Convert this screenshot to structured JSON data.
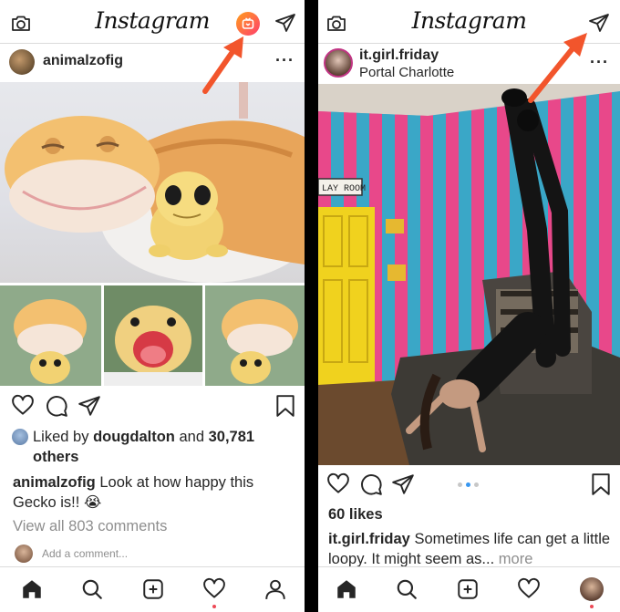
{
  "left": {
    "header": {
      "logo": "Instagram"
    },
    "post": {
      "username": "animalzofig",
      "liked_by_prefix": "Liked by",
      "liked_by_user": "dougdalton",
      "liked_by_and": "and",
      "liked_by_count": "30,781",
      "liked_by_suffix": "others",
      "caption_user": "animalzofig",
      "caption_text": "Look at how happy this Gecko is!! 😭",
      "view_comments": "View all 803 comments",
      "add_comment_placeholder": "Add a comment..."
    }
  },
  "right": {
    "header": {
      "logo": "Instagram"
    },
    "post": {
      "username": "it.girl.friday",
      "location": "Portal Charlotte",
      "wall_sign": "LAY ROOM",
      "likes": "60 likes",
      "caption_user": "it.girl.friday",
      "caption_text": "Sometimes life can get a little loopy. It might seem as...",
      "more_link": "more"
    }
  },
  "colors": {
    "accent_arrow": "#f2552c",
    "igtv_gradient_start": "#ff9f1c",
    "igtv_gradient_end": "#ff3d6e",
    "notification_dot": "#ed4956",
    "link_muted": "#8e8e8e"
  },
  "icons": [
    "camera-icon",
    "igtv-icon",
    "direct-send-icon",
    "more-icon",
    "heart-icon",
    "comment-icon",
    "share-icon",
    "bookmark-icon",
    "home-icon",
    "search-icon",
    "add-post-icon",
    "activity-heart-icon",
    "profile-icon"
  ]
}
